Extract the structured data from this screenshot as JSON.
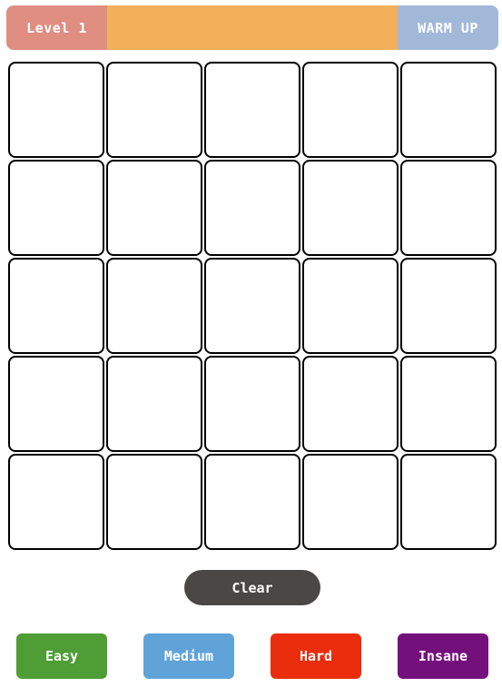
{
  "header": {
    "level_label": "Level 1",
    "mode_label": "WARM UP"
  },
  "grid": {
    "rows": 5,
    "cols": 5
  },
  "controls": {
    "clear_label": "Clear"
  },
  "difficulties": [
    {
      "label": "Easy",
      "color": "#4e9d35"
    },
    {
      "label": "Medium",
      "color": "#5fa3d9"
    },
    {
      "label": "Hard",
      "color": "#ea2d0c"
    },
    {
      "label": "Insane",
      "color": "#74107c"
    }
  ],
  "colors": {
    "level_bg": "#e08d82",
    "progress_bg": "#f2b05a",
    "mode_bg": "#a2b8d9",
    "clear_bg": "#4a4747"
  }
}
